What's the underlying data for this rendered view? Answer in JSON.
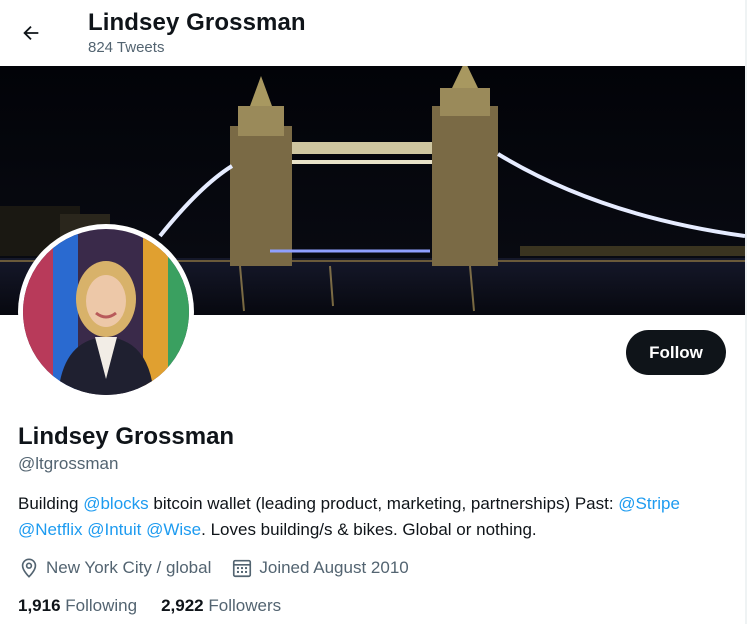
{
  "header": {
    "title": "Lindsey Grossman",
    "tweet_count": "824 Tweets"
  },
  "profile": {
    "display_name": "Lindsey Grossman",
    "handle": "@ltgrossman",
    "follow_label": "Follow",
    "bio": {
      "t1": "Building ",
      "m1": "@blocks",
      "t2": " bitcoin wallet (leading product, marketing, partnerships) Past: ",
      "m2": "@Stripe",
      "m3": "@Netflix",
      "m4": "@Intuit",
      "m5": "@Wise",
      "t3": ". Loves building/s & bikes. Global or nothing."
    },
    "location": "New York City / global",
    "joined": "Joined August 2010",
    "following_count": "1,916",
    "following_label": "Following",
    "followers_count": "2,922",
    "followers_label": "Followers"
  },
  "colors": {
    "link": "#1d9bf0",
    "secondary_text": "#536471",
    "primary_text": "#0f1419",
    "button_bg": "#0f1419"
  },
  "icons": [
    "back-arrow-icon",
    "location-pin-icon",
    "calendar-icon"
  ]
}
